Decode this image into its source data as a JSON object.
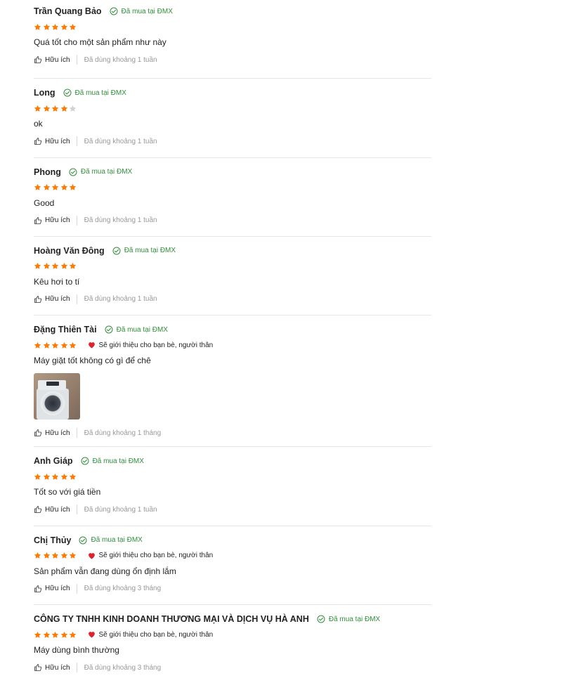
{
  "colors": {
    "star_filled": "#ff7a00",
    "star_empty": "#cfd3d8",
    "verified_green": "#2f8f3a",
    "heart_red": "#e0202a"
  },
  "labels": {
    "helpful": "Hữu ích",
    "verified": "Đã mua tại ĐMX",
    "recommend": "Sẽ giới thiệu cho bạn bè, người thân"
  },
  "icons": {
    "verified": "check-circle-icon",
    "helpful": "thumbs-up-icon",
    "recommend": "heart-icon",
    "rating": "star-icon"
  },
  "reviews": [
    {
      "name": "Trần Quang Bảo",
      "rating": 5,
      "recommend": false,
      "content": "Quá tốt cho một sản phẩm như này",
      "used": "Đã dùng khoảng 1 tuần",
      "has_photo": false
    },
    {
      "name": "Long",
      "rating": 4,
      "recommend": false,
      "content": "ok",
      "used": "Đã dùng khoảng 1 tuần",
      "has_photo": false
    },
    {
      "name": "Phong",
      "rating": 5,
      "recommend": false,
      "content": "Good",
      "used": "Đã dùng khoảng 1 tuần",
      "has_photo": false
    },
    {
      "name": "Hoàng Văn Đông",
      "rating": 5,
      "recommend": false,
      "content": "Kêu hơi to tí",
      "used": "Đã dùng khoảng 1 tuần",
      "has_photo": false
    },
    {
      "name": "Đặng Thiên Tài",
      "rating": 5,
      "recommend": true,
      "content": "Máy giặt tốt không có gì để chê",
      "used": "Đã dùng khoảng 1 tháng",
      "has_photo": true
    },
    {
      "name": "Anh Giáp",
      "rating": 5,
      "recommend": false,
      "content": "Tốt so với giá tiền",
      "used": "Đã dùng khoảng 1 tuần",
      "has_photo": false
    },
    {
      "name": "Chị Thủy",
      "rating": 5,
      "recommend": true,
      "content": "Sản phẩm vẫn đang dùng ổn định lắm",
      "used": "Đã dùng khoảng 3 tháng",
      "has_photo": false
    },
    {
      "name": "CÔNG TY TNHH KINH DOANH THƯƠNG MẠI VÀ DỊCH VỤ HÀ ANH",
      "rating": 5,
      "recommend": true,
      "content": "Máy dùng bình thường",
      "used": "Đã dùng khoảng 3 tháng",
      "has_photo": false
    }
  ]
}
